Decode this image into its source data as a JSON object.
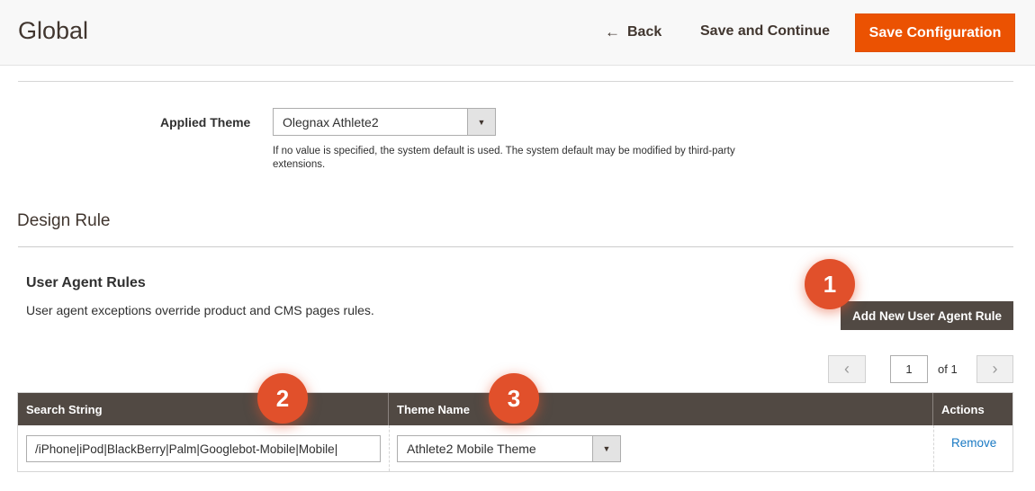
{
  "header": {
    "title": "Global",
    "back_label": "Back",
    "save_continue_label": "Save and Continue",
    "save_config_label": "Save Configuration",
    "accent_color": "#eb5202"
  },
  "applied_theme": {
    "label": "Applied Theme",
    "selected": "Olegnax Athlete2",
    "note": "If no value is specified, the system default is used. The system default may be modified by third-party extensions."
  },
  "design_rule": {
    "title": "Design Rule"
  },
  "user_agent_rules": {
    "title": "User Agent Rules",
    "description": "User agent exceptions override product and CMS pages rules.",
    "add_button_label": "Add New User Agent Rule",
    "pager": {
      "page": "1",
      "of_label": "of 1"
    },
    "columns": [
      "Search String",
      "Theme Name",
      "Actions"
    ],
    "rows": [
      {
        "search_string": "/iPhone|iPod|BlackBerry|Palm|Googlebot-Mobile|Mobile|",
        "theme": "Athlete2 Mobile Theme",
        "action": "Remove"
      }
    ]
  },
  "callouts": [
    "1",
    "2",
    "3"
  ],
  "icons": {
    "back": "arrow-left-icon",
    "dropdown": "chevron-down-icon",
    "prev": "chevron-left-icon",
    "next": "chevron-right-icon"
  }
}
